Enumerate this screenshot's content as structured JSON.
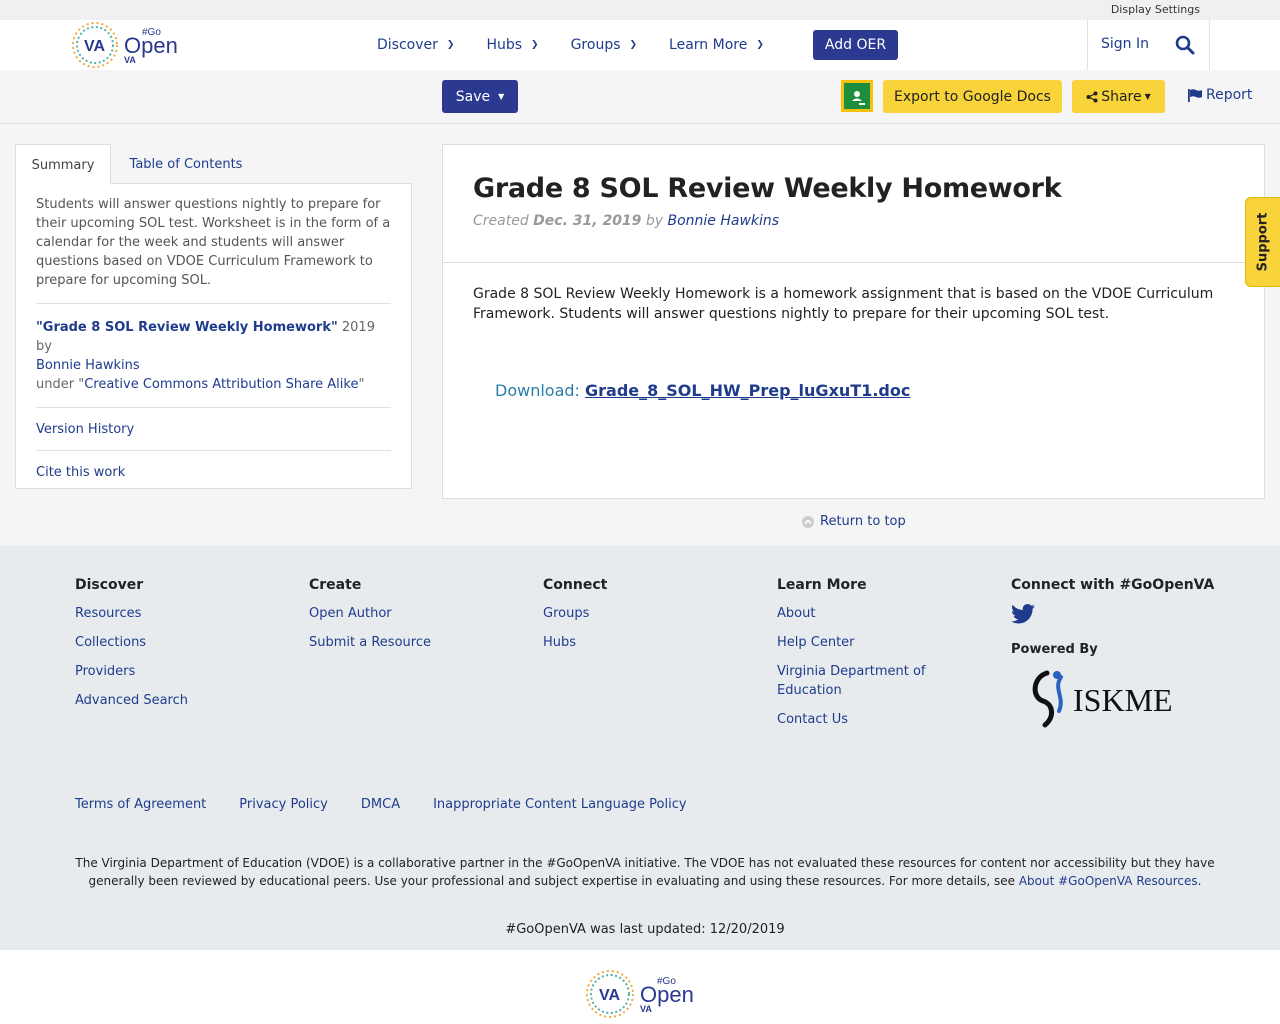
{
  "util": {
    "display_settings": "Display Settings"
  },
  "header": {
    "logo": {
      "va": "VA",
      "go": "#Go",
      "open": "Open",
      "va_small": "VA"
    },
    "nav": [
      {
        "label": "Discover"
      },
      {
        "label": "Hubs"
      },
      {
        "label": "Groups"
      },
      {
        "label": "Learn More"
      }
    ],
    "add_oer": "Add OER",
    "sign_in": "Sign In"
  },
  "toolbar": {
    "save": "Save",
    "export": "Export to Google Docs",
    "share": "Share",
    "report": "Report"
  },
  "sidebar": {
    "tabs": [
      "Summary",
      "Table of Contents"
    ],
    "summary": "Students will answer questions nightly to prepare for their upcoming SOL test. Worksheet is in the form of a calendar for the week and students will answer questions based on VDOE Curriculum Framework to prepare for upcoming SOL.",
    "attribution": {
      "title": "\"Grade 8 SOL Review Weekly Homework\"",
      "year_by": " 2019 by",
      "author": "Bonnie Hawkins",
      "under": "under \"",
      "license": "Creative Commons Attribution Share Alike",
      "close_quote": "\""
    },
    "version_history": "Version History",
    "cite": "Cite this work"
  },
  "main": {
    "title": "Grade 8 SOL Review Weekly Homework",
    "created_label": "Created",
    "created_date": "Dec. 31, 2019",
    "by_label": "by",
    "author": "Bonnie Hawkins",
    "description": "Grade 8 SOL Review Weekly Homework is a homework assignment that is based on the VDOE Curriculum Framework.  Students will answer questions nightly to prepare for their upcoming SOL test.",
    "download_label": "Download:",
    "download_file": "Grade_8_SOL_HW_Prep_luGxuT1.doc"
  },
  "return_top": "Return to top",
  "support": "Support",
  "footer": {
    "columns": [
      {
        "title": "Discover",
        "links": [
          "Resources",
          "Collections",
          "Providers",
          "Advanced Search"
        ]
      },
      {
        "title": "Create",
        "links": [
          "Open Author",
          "Submit a Resource"
        ]
      },
      {
        "title": "Connect",
        "links": [
          "Groups",
          "Hubs"
        ]
      },
      {
        "title": "Learn More",
        "links": [
          "About",
          "Help Center",
          "Virginia Department of Education",
          "Contact Us"
        ]
      }
    ],
    "connect_title": "Connect with #GoOpenVA",
    "powered_by": "Powered By",
    "iskme": "ISKME",
    "legal": [
      "Terms of Agreement",
      "Privacy Policy",
      "DMCA",
      "Inappropriate Content Language Policy"
    ],
    "disclaimer": "The Virginia Department of Education (VDOE) is a collaborative partner in the #GoOpenVA initiative. The VDOE has not evaluated these resources for content nor accessibility but they have generally been reviewed by educational peers. Use your professional and subject expertise in evaluating and using these resources. For more details, see ",
    "disclaimer_link": "About #GoOpenVA Resources",
    "disclaimer_end": ".",
    "updated": "#GoOpenVA was last updated: 12/20/2019"
  },
  "colors": {
    "primary": "#2b3990",
    "link": "#1f3c8c",
    "accent_yellow": "#f8d43a"
  }
}
